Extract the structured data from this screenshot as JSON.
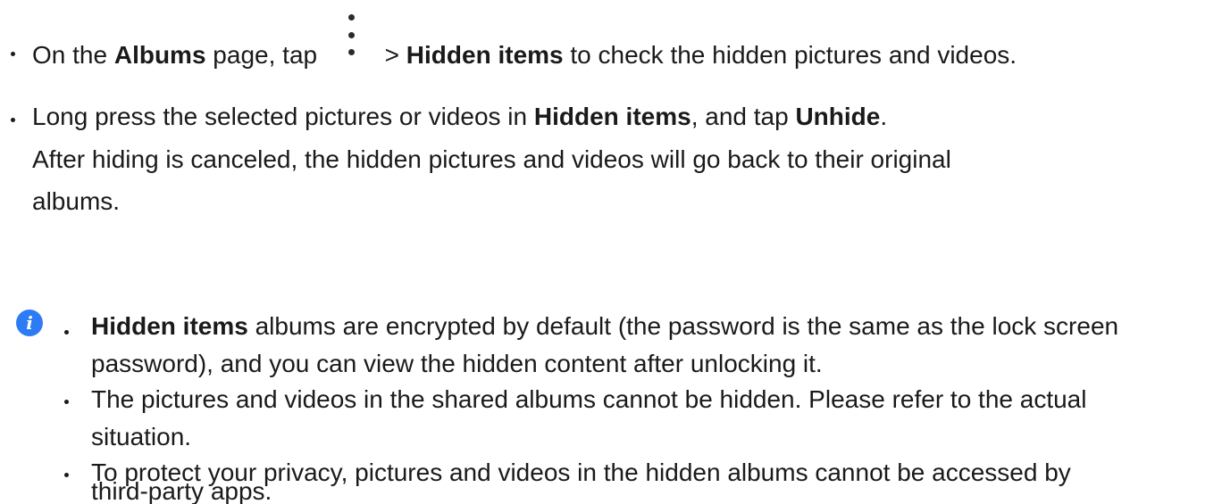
{
  "steps": [
    {
      "part1": "On the ",
      "bold1": "Albums",
      "part2": " page, tap ",
      "icon": "more-vertical-icon",
      "part3": " > ",
      "bold2": "Hidden items",
      "part4": " to check the hidden pictures and videos."
    },
    {
      "part1": "Long press the selected pictures or videos in ",
      "bold1": "Hidden items",
      "part2": ", and tap ",
      "bold2": "Unhide",
      "part3": ".",
      "line2": "After hiding is canceled, the hidden pictures and videos will go back to their original",
      "line3": "albums."
    }
  ],
  "note": {
    "icon": "info-icon",
    "icon_glyph": "i",
    "items": [
      {
        "bold": "Hidden items",
        "line1_rest": " albums are encrypted by default (the password is the same as the lock screen",
        "line2": "password), and you can view the hidden content after unlocking it."
      },
      {
        "line1": "The pictures and videos in the shared albums cannot be hidden. Please refer to the actual",
        "line2": "situation."
      },
      {
        "line1": "To protect your privacy, pictures and videos in the hidden albums cannot be accessed by",
        "line2": "third-party apps."
      }
    ]
  },
  "colors": {
    "text": "#1a1a1a",
    "info_accent": "#2d7cf6"
  }
}
